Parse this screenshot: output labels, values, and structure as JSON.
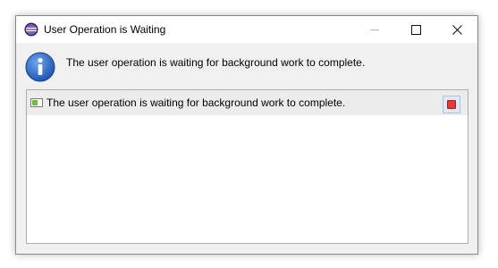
{
  "window": {
    "title": "User Operation is Waiting",
    "app_icon": "eclipse-icon",
    "controls": {
      "minimize_icon": "minimize-icon",
      "maximize_icon": "maximize-icon",
      "close_icon": "close-icon"
    }
  },
  "dialog": {
    "icon": "info-icon",
    "message": "The user operation is waiting for background work to complete."
  },
  "jobs": [
    {
      "icon": "progress-job-icon",
      "label": "The user operation is waiting for background work to complete.",
      "stop_icon": "stop-icon"
    }
  ],
  "colors": {
    "stop": "#e53935",
    "info": "#1f5fc4",
    "job_icon": "#6abf3c"
  }
}
